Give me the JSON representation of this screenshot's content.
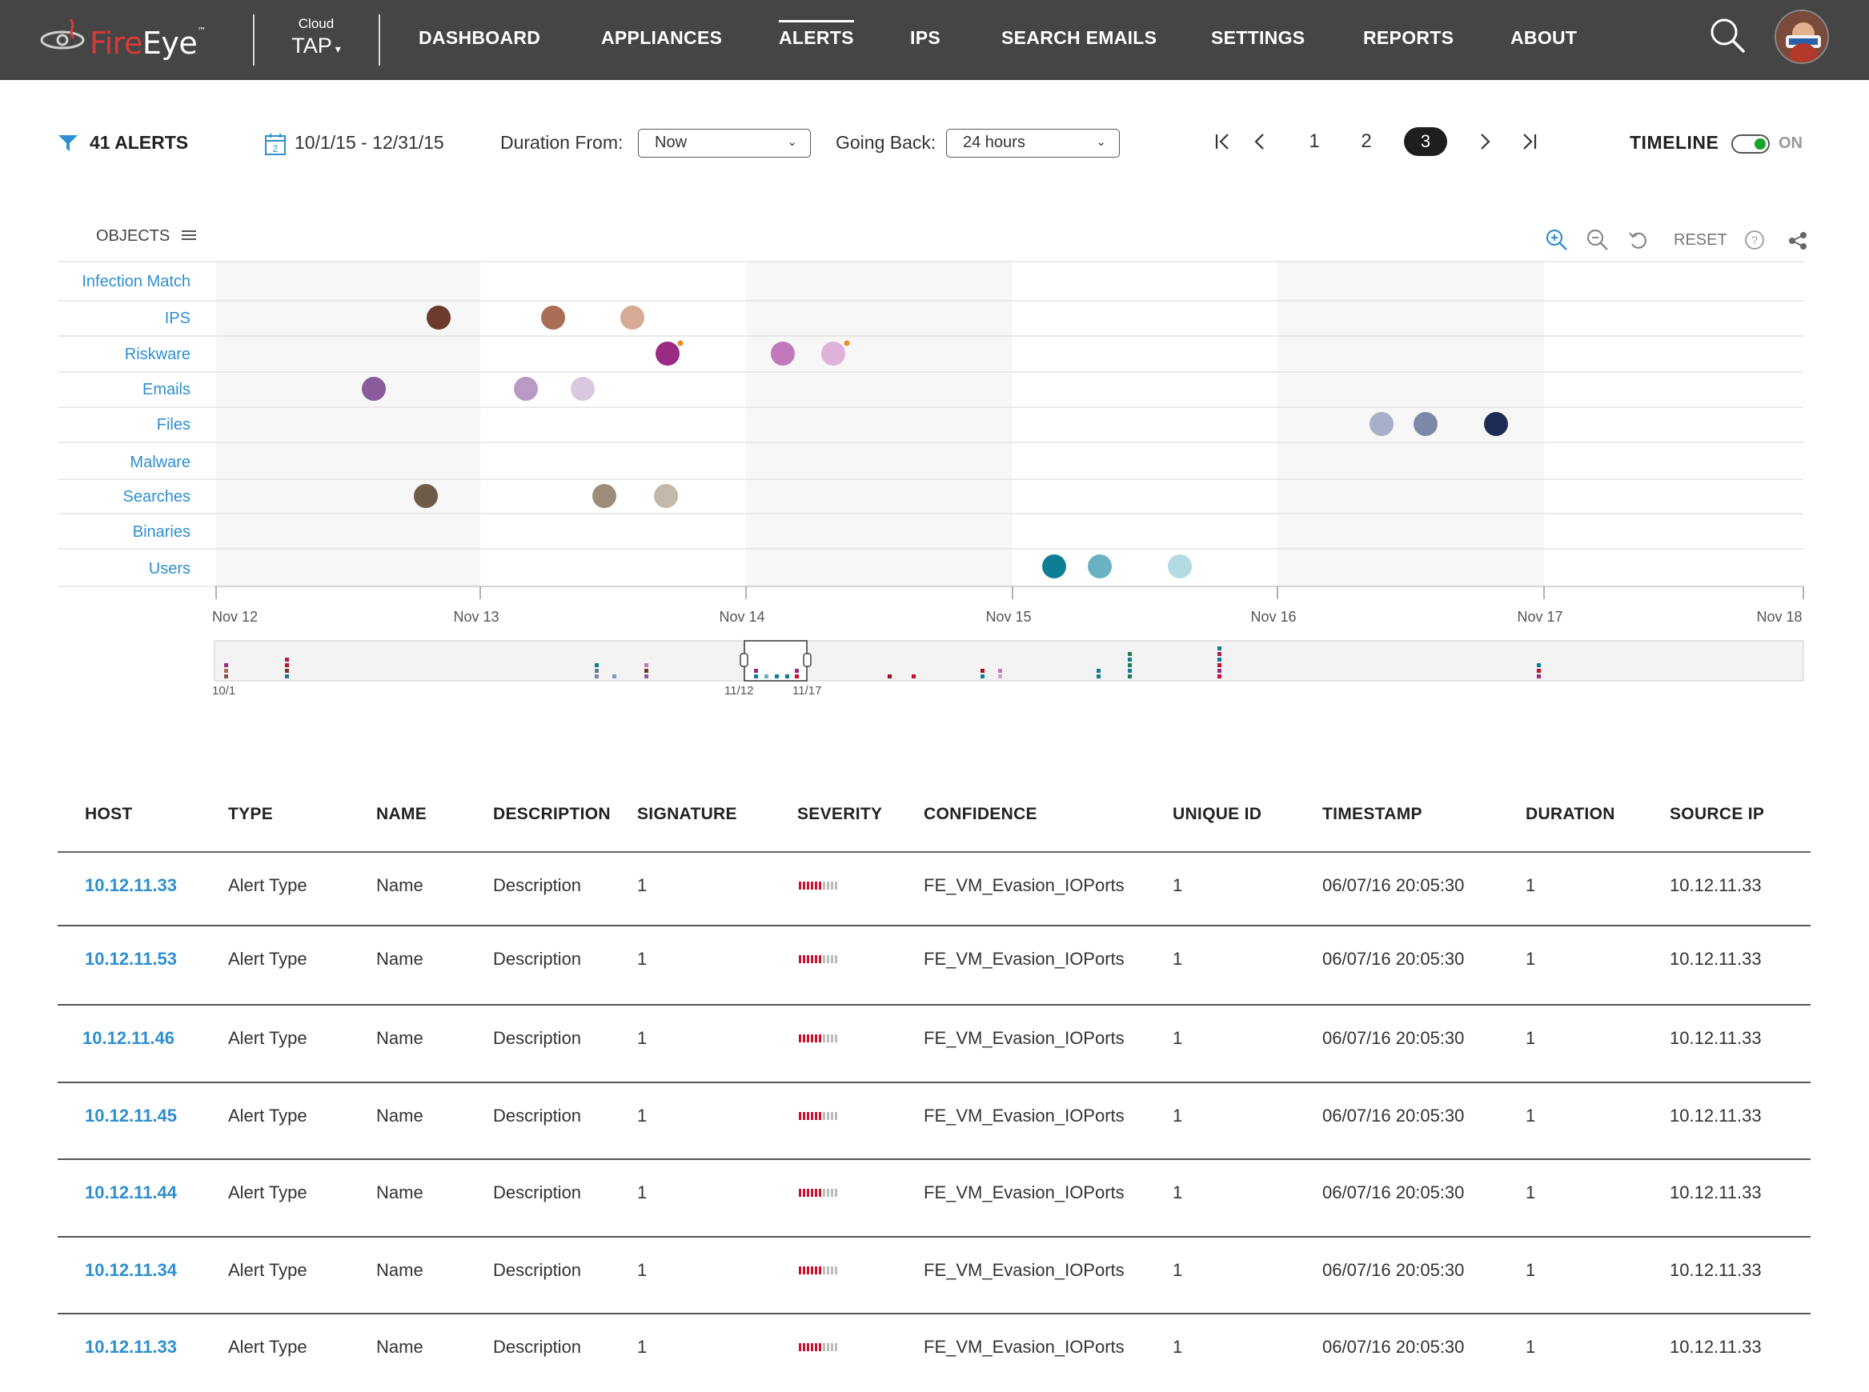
{
  "brand": {
    "logo_text_a": "Fire",
    "logo_text_b": "Eye",
    "tm": "™"
  },
  "product": {
    "line1": "Cloud",
    "line2": "TAP"
  },
  "nav": {
    "items": [
      {
        "label": "DASHBOARD"
      },
      {
        "label": "APPLIANCES"
      },
      {
        "label": "ALERTS",
        "active": true
      },
      {
        "label": "IPS"
      },
      {
        "label": "SEARCH EMAILS"
      },
      {
        "label": "SETTINGS"
      },
      {
        "label": "REPORTS"
      },
      {
        "label": "ABOUT"
      }
    ]
  },
  "toolbar": {
    "alerts_count": "41 ALERTS",
    "calendar_day": "2",
    "date_range": "10/1/15 - 12/31/15",
    "duration_label": "Duration From:",
    "duration_value": "Now",
    "going_back_label": "Going Back:",
    "going_back_value": "24 hours",
    "pages": [
      "1",
      "2",
      "3"
    ],
    "current_page": "3",
    "timeline_label": "TIMELINE",
    "timeline_state": "ON"
  },
  "timeline": {
    "objects_label": "OBJECTS",
    "reset_label": "RESET",
    "rows": [
      "Infection Match",
      "IPS",
      "Riskware",
      "Emails",
      "Files",
      "Malware",
      "Searches",
      "Binaries",
      "Users"
    ],
    "axis_ticks": [
      "Nov 12",
      "Nov 13",
      "Nov 14",
      "Nov 15",
      "Nov 16",
      "Nov 17",
      "Nov 18"
    ],
    "navigator_labels": [
      "10/1",
      "11/12",
      "11/17"
    ]
  },
  "table": {
    "headers": [
      "HOST",
      "TYPE",
      "NAME",
      "DESCRIPTION",
      "SIGNATURE",
      "SEVERITY",
      "CONFIDENCE",
      "UNIQUE ID",
      "TIMESTAMP",
      "DURATION",
      "SOURCE IP"
    ],
    "rows": [
      {
        "host": "10.12.11.33",
        "type": "Alert Type",
        "name": "Name",
        "description": "Description",
        "signature": "1",
        "confidence": "FE_VM_Evasion_IOPorts",
        "unique_id": "1",
        "timestamp": "06/07/16  20:05:30",
        "duration": "1",
        "source_ip": "10.12.11.33"
      },
      {
        "host": "10.12.11.53",
        "type": "Alert Type",
        "name": "Name",
        "description": "Description",
        "signature": "1",
        "confidence": "FE_VM_Evasion_IOPorts",
        "unique_id": "1",
        "timestamp": "06/07/16  20:05:30",
        "duration": "1",
        "source_ip": "10.12.11.33"
      },
      {
        "host": "10.12.11.46",
        "type": "Alert Type",
        "name": "Name",
        "description": "Description",
        "signature": "1",
        "confidence": "FE_VM_Evasion_IOPorts",
        "unique_id": "1",
        "timestamp": "06/07/16  20:05:30",
        "duration": "1",
        "source_ip": "10.12.11.33"
      },
      {
        "host": "10.12.11.45",
        "type": "Alert Type",
        "name": "Name",
        "description": "Description",
        "signature": "1",
        "confidence": "FE_VM_Evasion_IOPorts",
        "unique_id": "1",
        "timestamp": "06/07/16  20:05:30",
        "duration": "1",
        "source_ip": "10.12.11.33"
      },
      {
        "host": "10.12.11.44",
        "type": "Alert Type",
        "name": "Name",
        "description": "Description",
        "signature": "1",
        "confidence": "FE_VM_Evasion_IOPorts",
        "unique_id": "1",
        "timestamp": "06/07/16  20:05:30",
        "duration": "1",
        "source_ip": "10.12.11.33"
      },
      {
        "host": "10.12.11.34",
        "type": "Alert Type",
        "name": "Name",
        "description": "Description",
        "signature": "1",
        "confidence": "FE_VM_Evasion_IOPorts",
        "unique_id": "1",
        "timestamp": "06/07/16  20:05:30",
        "duration": "1",
        "source_ip": "10.12.11.33"
      },
      {
        "host": "10.12.11.33",
        "type": "Alert Type",
        "name": "Name",
        "description": "Description",
        "signature": "1",
        "confidence": "FE_VM_Evasion_IOPorts",
        "unique_id": "1",
        "timestamp": "06/07/16  20:05:30",
        "duration": "1",
        "source_ip": "10.12.11.33"
      }
    ]
  },
  "colors": {
    "nav_bg": "#454545",
    "link_blue": "#2e8fd0",
    "toggle_on": "#19a52b",
    "severity_on": "#c8102e",
    "severity_off": "#bbbbbb"
  }
}
